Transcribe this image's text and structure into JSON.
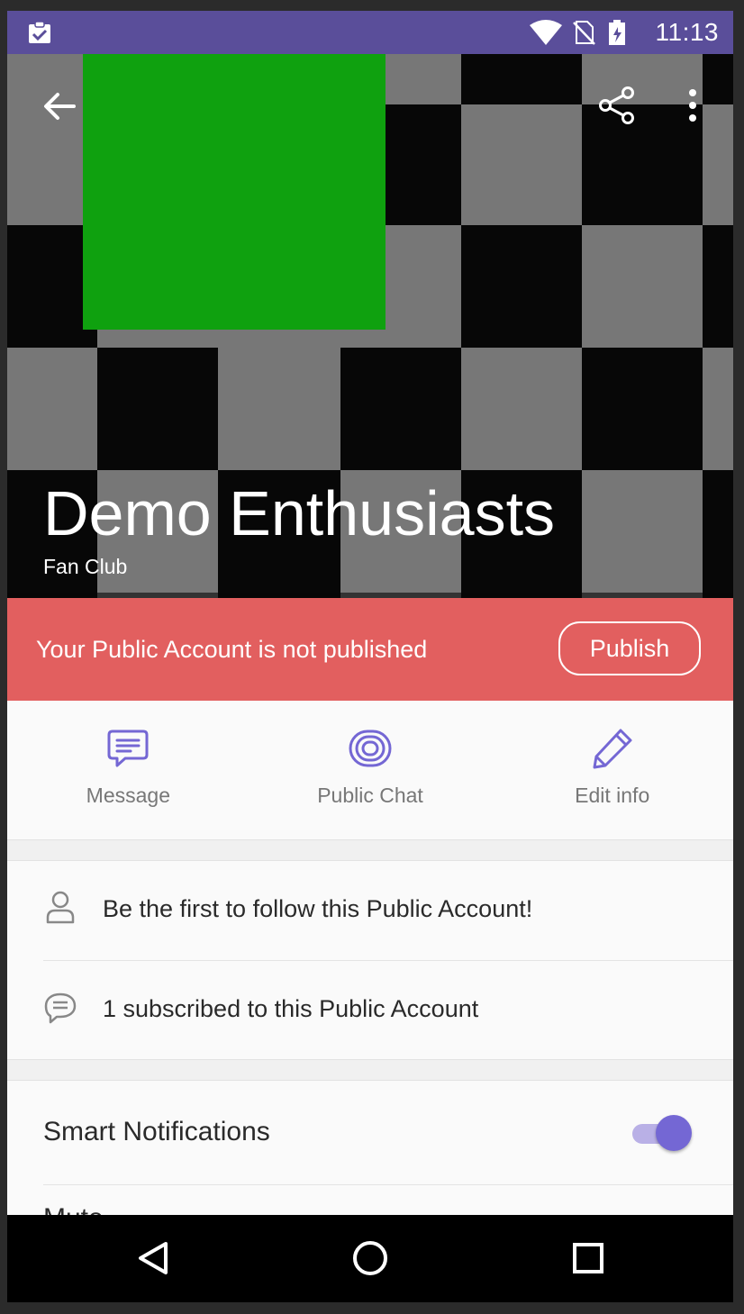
{
  "status_bar": {
    "time": "11:13",
    "icons": [
      "clipboard-check-icon",
      "wifi-icon",
      "no-sim-icon",
      "battery-charging-icon"
    ]
  },
  "header": {
    "title": "Demo Enthusiasts",
    "subtitle": "Fan Club",
    "back_icon": "arrow-left-icon",
    "share_icon": "share-icon",
    "more_icon": "more-vert-icon"
  },
  "banner": {
    "message": "Your Public Account is not published",
    "button_label": "Publish",
    "color": "#e25f5f"
  },
  "actions": [
    {
      "label": "Message",
      "icon": "message-bubble-icon"
    },
    {
      "label": "Public Chat",
      "icon": "public-chat-icon"
    },
    {
      "label": "Edit info",
      "icon": "pencil-icon"
    }
  ],
  "info_rows": [
    {
      "text": "Be the first to follow this Public Account!",
      "icon": "person-icon"
    },
    {
      "text": "1 subscribed to this Public Account",
      "icon": "chat-bubble-icon"
    }
  ],
  "settings": {
    "smart_notifications_label": "Smart Notifications",
    "smart_notifications_on": true,
    "mute_label": "Mute"
  },
  "colors": {
    "accent": "#7467d4",
    "status_bar": "#5a4e9a",
    "green_block": "#0fa10f"
  },
  "nav_bar": [
    "back-triangle-icon",
    "home-circle-icon",
    "recents-square-icon"
  ]
}
